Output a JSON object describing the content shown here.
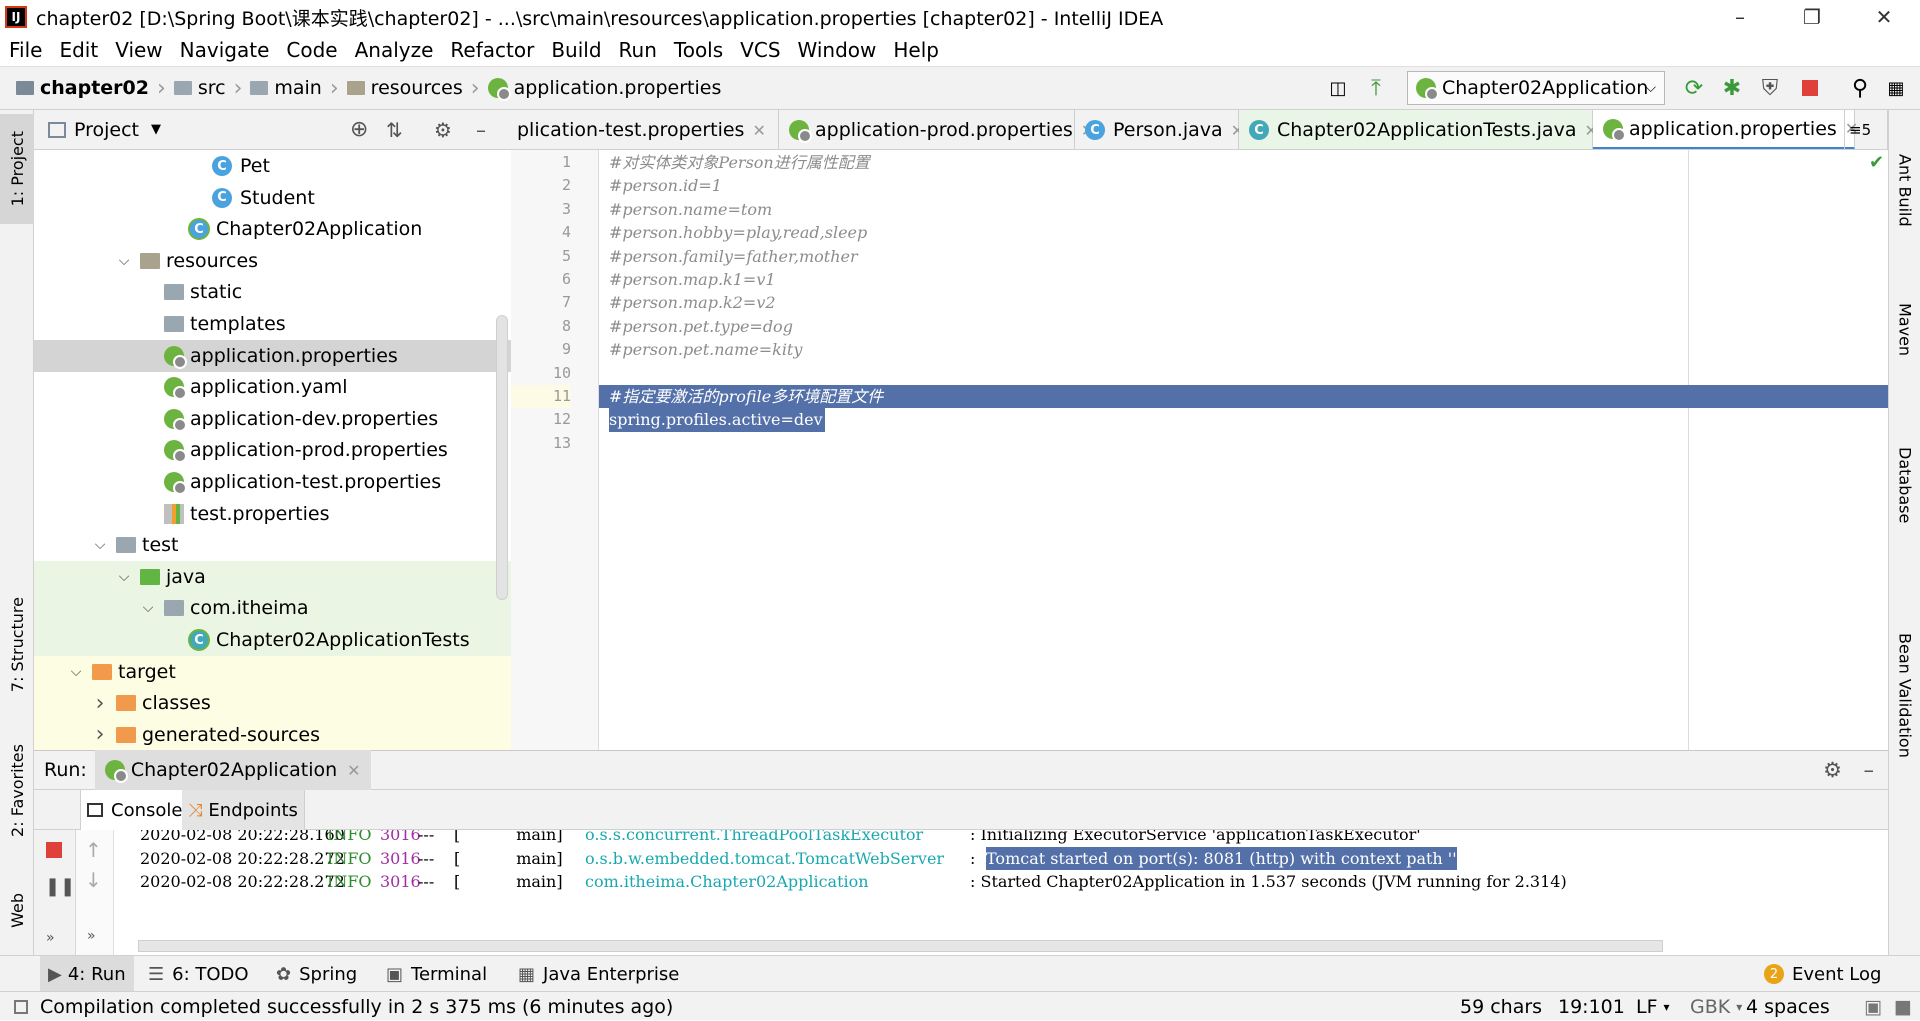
{
  "window": {
    "title": "chapter02 [D:\\Spring Boot\\课本实践\\chapter02] - ...\\src\\main\\resources\\application.properties [chapter02] - IntelliJ IDEA",
    "app_icon": "IJ"
  },
  "menu": [
    "File",
    "Edit",
    "View",
    "Navigate",
    "Code",
    "Analyze",
    "Refactor",
    "Build",
    "Run",
    "Tools",
    "VCS",
    "Window",
    "Help"
  ],
  "breadcrumb": [
    "chapter02",
    "src",
    "main",
    "resources",
    "application.properties"
  ],
  "run_config": "Chapter02Application",
  "project_panel": {
    "title": "Project",
    "tree": [
      {
        "label": "Pet",
        "depth": 7,
        "icon": "class-icon",
        "arrow": ""
      },
      {
        "label": "Student",
        "depth": 7,
        "icon": "class-icon",
        "arrow": ""
      },
      {
        "label": "Chapter02Application",
        "depth": 6,
        "icon": "spring-boot-class-icon",
        "arrow": ""
      },
      {
        "label": "resources",
        "depth": 4,
        "icon": "resources-folder-icon",
        "arrow": "v"
      },
      {
        "label": "static",
        "depth": 5,
        "icon": "folder-icon",
        "arrow": ""
      },
      {
        "label": "templates",
        "depth": 5,
        "icon": "folder-icon",
        "arrow": ""
      },
      {
        "label": "application.properties",
        "depth": 5,
        "icon": "spring-properties-icon",
        "arrow": "",
        "selected": true
      },
      {
        "label": "application.yaml",
        "depth": 5,
        "icon": "spring-properties-icon",
        "arrow": ""
      },
      {
        "label": "application-dev.properties",
        "depth": 5,
        "icon": "spring-properties-icon",
        "arrow": ""
      },
      {
        "label": "application-prod.properties",
        "depth": 5,
        "icon": "spring-properties-icon",
        "arrow": ""
      },
      {
        "label": "application-test.properties",
        "depth": 5,
        "icon": "spring-properties-icon",
        "arrow": ""
      },
      {
        "label": "test.properties",
        "depth": 5,
        "icon": "properties-file-icon",
        "arrow": ""
      },
      {
        "label": "test",
        "depth": 3,
        "icon": "folder-icon",
        "arrow": "v"
      },
      {
        "label": "java",
        "depth": 4,
        "icon": "test-folder-icon",
        "arrow": "v",
        "bg": "test"
      },
      {
        "label": "com.itheima",
        "depth": 5,
        "icon": "package-icon",
        "arrow": "v",
        "bg": "test"
      },
      {
        "label": "Chapter02ApplicationTests",
        "depth": 6,
        "icon": "test-class-icon",
        "arrow": "",
        "bg": "test"
      },
      {
        "label": "target",
        "depth": 2,
        "icon": "excluded-folder-icon",
        "arrow": "v",
        "bg": "target"
      },
      {
        "label": "classes",
        "depth": 3,
        "icon": "excluded-folder-icon",
        "arrow": ">",
        "bg": "target"
      },
      {
        "label": "generated-sources",
        "depth": 3,
        "icon": "excluded-folder-icon",
        "arrow": ">",
        "bg": "target"
      }
    ]
  },
  "editor_tabs": [
    {
      "label": "plication-test.properties",
      "icon": "",
      "active": false
    },
    {
      "label": "application-prod.properties",
      "icon": "spring-properties-icon",
      "active": false
    },
    {
      "label": "Person.java",
      "icon": "class-icon",
      "active": false
    },
    {
      "label": "Chapter02ApplicationTests.java",
      "icon": "test-class-icon",
      "active": false,
      "green": true
    },
    {
      "label": "application.properties",
      "icon": "spring-properties-icon",
      "active": true
    }
  ],
  "tab_overflow": "≡5",
  "editor_lines": [
    {
      "n": "1",
      "text": "#对实体类对象Person进行属性配置",
      "kind": "comment"
    },
    {
      "n": "2",
      "text": "#person.id=1",
      "kind": "comment"
    },
    {
      "n": "3",
      "text": "#person.name=tom",
      "kind": "comment"
    },
    {
      "n": "4",
      "text": "#person.hobby=play,read,sleep",
      "kind": "comment"
    },
    {
      "n": "5",
      "text": "#person.family=father,mother",
      "kind": "comment"
    },
    {
      "n": "6",
      "text": "#person.map.k1=v1",
      "kind": "comment"
    },
    {
      "n": "7",
      "text": "#person.map.k2=v2",
      "kind": "comment"
    },
    {
      "n": "8",
      "text": "#person.pet.type=dog",
      "kind": "comment"
    },
    {
      "n": "9",
      "text": "#person.pet.name=kity",
      "kind": "comment"
    },
    {
      "n": "10",
      "text": "",
      "kind": "plain"
    },
    {
      "n": "11",
      "text": "#指定要激活的profile多环境配置文件",
      "kind": "selected-comment"
    },
    {
      "n": "12",
      "text": "spring.profiles.active=dev",
      "kind": "selected"
    },
    {
      "n": "13",
      "text": "",
      "kind": "plain"
    }
  ],
  "run_panel": {
    "label": "Run:",
    "config": "Chapter02Application",
    "tabs": [
      "Console",
      "Endpoints"
    ],
    "console": [
      {
        "ts": "2020-02-08 20:22:28.160",
        "level": "INFO",
        "pid": "3016",
        "dashes": "---",
        "thread": "[           main]",
        "logger": "o.s.s.concurrent.ThreadPoolTaskExecutor",
        "msg": ": Initializing ExecutorService 'applicationTaskExecutor'",
        "hl": false
      },
      {
        "ts": "2020-02-08 20:22:28.272",
        "level": "INFO",
        "pid": "3016",
        "dashes": "---",
        "thread": "[           main]",
        "logger": "o.s.b.w.embedded.tomcat.TomcatWebServer",
        "msg": "Tomcat started on port(s): 8081 (http) with context path ''",
        "hl": true
      },
      {
        "ts": "2020-02-08 20:22:28.272",
        "level": "INFO",
        "pid": "3016",
        "dashes": "---",
        "thread": "[           main]",
        "logger": "com.itheima.Chapter02Application",
        "msg": ": Started Chapter02Application in 1.537 seconds (JVM running for 2.314)",
        "hl": false
      }
    ]
  },
  "left_strip": [
    "1: Project",
    "7: Structure",
    "2: Favorites",
    "Web"
  ],
  "right_strip": [
    "Ant Build",
    "Maven",
    "Database",
    "Bean Validation"
  ],
  "bottom_tools": [
    {
      "label": "4: Run",
      "icon": "run-icon"
    },
    {
      "label": "6: TODO",
      "icon": "todo-icon"
    },
    {
      "label": "Spring",
      "icon": "spring-icon"
    },
    {
      "label": "Terminal",
      "icon": "terminal-icon"
    },
    {
      "label": "Java Enterprise",
      "icon": "java-enterprise-icon"
    }
  ],
  "event_log": {
    "label": "Event Log",
    "count": "2"
  },
  "status": {
    "message": "Compilation completed successfully in 2 s 375 ms (6 minutes ago)",
    "chars": "59 chars",
    "position": "19:101",
    "line_sep": "LF",
    "encoding": "GBK",
    "indent": "4 spaces"
  },
  "colors": {
    "selection": "#5470a8",
    "accent": "#4083c9",
    "spring": "#6db33f",
    "stop": "#e0403a"
  }
}
